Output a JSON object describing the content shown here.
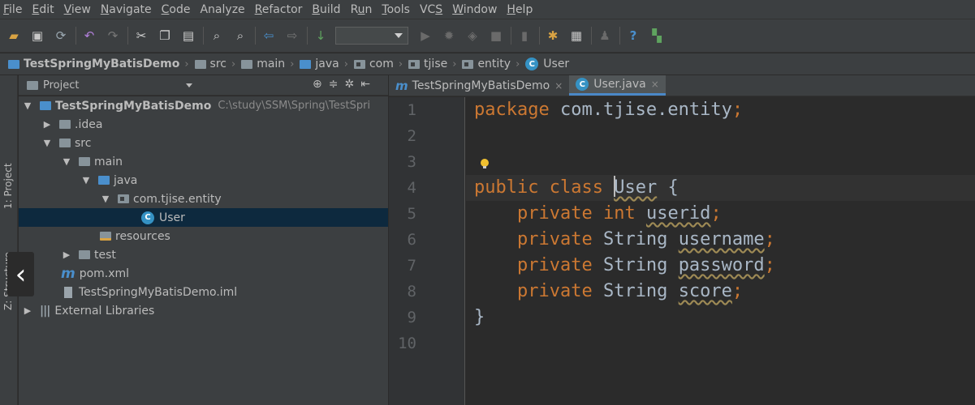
{
  "menu": [
    "File",
    "Edit",
    "View",
    "Navigate",
    "Code",
    "Analyze",
    "Refactor",
    "Build",
    "Run",
    "Tools",
    "VCS",
    "Window",
    "Help"
  ],
  "menu_mnemonics": [
    "F",
    "E",
    "V",
    "N",
    "C",
    "",
    "R",
    "B",
    "u",
    "T",
    "S",
    "W",
    "H"
  ],
  "toolbar": {
    "icons": [
      "open-icon",
      "save-icon",
      "sync-icon",
      "undo-icon",
      "redo-icon",
      "cut-icon",
      "copy-icon",
      "paste-icon",
      "find-icon",
      "replace-icon",
      "back-icon",
      "forward-icon",
      "build-icon",
      "run-config-combo",
      "run-icon",
      "debug-icon",
      "coverage-icon",
      "stop-icon",
      "vcs-icon",
      "settings-icon",
      "project-structure-icon",
      "sdk-icon",
      "help-icon",
      "sync-gradle-icon"
    ],
    "run_config_value": ""
  },
  "breadcrumb": [
    "TestSpringMyBatisDemo",
    "src",
    "main",
    "java",
    "com",
    "tjise",
    "entity",
    "User"
  ],
  "side_stripe": {
    "project_label": "1: Project",
    "structure_label": "Z: Structure"
  },
  "project_panel": {
    "title": "Project",
    "tree": [
      {
        "label": "TestSpringMyBatisDemo",
        "path": "C:\\study\\SSM\\Spring\\TestSpri",
        "toggle": "▼"
      },
      {
        "label": ".idea",
        "toggle": "▶"
      },
      {
        "label": "src",
        "toggle": "▼"
      },
      {
        "label": "main",
        "toggle": "▼"
      },
      {
        "label": "java",
        "toggle": "▼"
      },
      {
        "label": "com.tjise.entity",
        "toggle": "▼"
      },
      {
        "label": "User",
        "toggle": ""
      },
      {
        "label": "resources",
        "toggle": ""
      },
      {
        "label": "test",
        "toggle": "▶"
      },
      {
        "label": "pom.xml",
        "toggle": ""
      },
      {
        "label": "TestSpringMyBatisDemo.iml",
        "toggle": ""
      },
      {
        "label": "External Libraries",
        "toggle": "▶"
      }
    ]
  },
  "tabs": [
    {
      "label": "TestSpringMyBatisDemo",
      "close": "×",
      "active": false
    },
    {
      "label": "User.java",
      "close": "×",
      "active": true
    }
  ],
  "editor": {
    "line_numbers": [
      "1",
      "2",
      "3",
      "4",
      "5",
      "6",
      "7",
      "8",
      "9",
      "10"
    ],
    "code": {
      "l1_kw": "package",
      "l1_rest": " com.tjise.entity",
      "l1_semi": ";",
      "l4_kw1": "public",
      "l4_kw2": "class",
      "l4_name": "User",
      "l4_brace": " {",
      "field_kw": "private",
      "f1_type": "int",
      "f1_name": "userid",
      "f2_type": "String",
      "f2_name": "username",
      "f3_type": "String",
      "f3_name": "password",
      "f4_type": "String",
      "f4_name": "score",
      "semi": ";",
      "l9_brace": "}"
    }
  },
  "overlay": {
    "back_glyph": "‹"
  },
  "colors": {
    "keyword": "#cc7832",
    "text": "#a9b7c6",
    "line_number": "#606366",
    "selection": "#0d293e",
    "tab_underline": "#4a88c7",
    "class_badge": "#3592c4"
  }
}
